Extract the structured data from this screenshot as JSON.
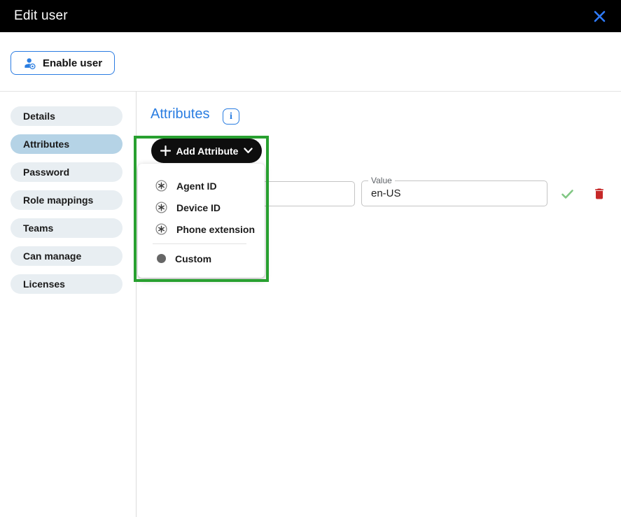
{
  "header": {
    "title": "Edit user"
  },
  "toolbar": {
    "enable_user_label": "Enable user"
  },
  "sidebar": {
    "items": [
      {
        "label": "Details",
        "selected": false
      },
      {
        "label": "Attributes",
        "selected": true
      },
      {
        "label": "Password",
        "selected": false
      },
      {
        "label": "Role mappings",
        "selected": false
      },
      {
        "label": "Teams",
        "selected": false
      },
      {
        "label": "Can manage",
        "selected": false
      },
      {
        "label": "Licenses",
        "selected": false
      }
    ]
  },
  "main": {
    "heading": "Attributes",
    "info_label": "i",
    "add_attribute_label": "Add Attribute",
    "menu": {
      "items": [
        {
          "label": "Agent ID",
          "icon": "circled-asterisk-icon"
        },
        {
          "label": "Device ID",
          "icon": "circled-asterisk-icon"
        },
        {
          "label": "Phone extension",
          "icon": "circled-asterisk-icon"
        },
        {
          "label": "Custom",
          "icon": "filled-circle-icon"
        }
      ]
    },
    "attribute_row": {
      "key_field": {
        "value": ""
      },
      "value_field": {
        "label": "Value",
        "value": "en-US"
      }
    }
  },
  "icons": {
    "close": "x-cross",
    "person": "person-with-badge",
    "plus": "+",
    "chevron_down": "v",
    "info": "i",
    "circled_asterisk": "asterisk-in-circle",
    "filled_circle": "solid-dot",
    "confirm": "checkmark",
    "delete": "trash-can"
  },
  "colors": {
    "header_bg": "#000000",
    "accent_blue": "#2a7de1",
    "close_blue": "#2e7bff",
    "sidebar_item_bg": "#e8eef2",
    "sidebar_selected_bg": "#b5d3e6",
    "add_button_bg": "#0e0e0e",
    "annotation_green": "#28a030",
    "confirm_green": "#81c784",
    "delete_red": "#c62828",
    "field_border": "#c4c4c4"
  }
}
